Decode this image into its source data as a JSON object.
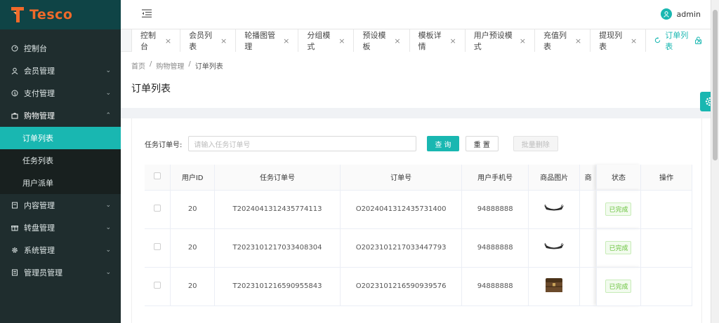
{
  "brand": {
    "name": "Tesco"
  },
  "sidebar": {
    "items": [
      {
        "label": "控制台",
        "icon": "dashboard-icon"
      },
      {
        "label": "会员管理",
        "icon": "user-icon"
      },
      {
        "label": "支付管理",
        "icon": "dollar-icon"
      },
      {
        "label": "购物管理",
        "icon": "bag-icon",
        "open": true
      },
      {
        "label": "订单列表",
        "sub": true,
        "active": true
      },
      {
        "label": "任务列表",
        "sub": true
      },
      {
        "label": "用户派单",
        "sub": true
      },
      {
        "label": "内容管理",
        "icon": "book-icon"
      },
      {
        "label": "转盘管理",
        "icon": "gift-icon"
      },
      {
        "label": "系统管理",
        "icon": "gear-icon"
      },
      {
        "label": "管理员管理",
        "icon": "doc-icon"
      }
    ]
  },
  "header": {
    "user": "admin"
  },
  "tabs": [
    {
      "label": "控制台"
    },
    {
      "label": "会员列表"
    },
    {
      "label": "轮播图管理"
    },
    {
      "label": "分组模式"
    },
    {
      "label": "预设模板"
    },
    {
      "label": "模板详情"
    },
    {
      "label": "用户预设模式"
    },
    {
      "label": "充值列表"
    },
    {
      "label": "提现列表"
    },
    {
      "label": "订单列表",
      "active": true
    }
  ],
  "breadcrumb": {
    "home": "首页",
    "section": "购物管理",
    "current": "订单列表"
  },
  "page": {
    "title": "订单列表"
  },
  "search": {
    "label": "任务订单号:",
    "placeholder": "请输入任务订单号",
    "query_btn": "查 询",
    "reset_btn": "重 置",
    "batch_delete_btn": "批量删除"
  },
  "table": {
    "columns": [
      "用户ID",
      "任务订单号",
      "订单号",
      "用户手机号",
      "商品图片",
      "商",
      "状态",
      "操作"
    ],
    "rows": [
      {
        "user_id": "20",
        "task_no": "T2024041312435774113",
        "order_no": "O2024041312435731400",
        "phone": "94888888",
        "image": "boat",
        "status": "已完成"
      },
      {
        "user_id": "20",
        "task_no": "T2023101217033408304",
        "order_no": "O2023101217033447793",
        "phone": "94888888",
        "image": "boat",
        "status": "已完成"
      },
      {
        "user_id": "20",
        "task_no": "T2023101216590955843",
        "order_no": "O2023101216590939576",
        "phone": "94888888",
        "image": "chest",
        "status": "已完成"
      }
    ]
  },
  "colors": {
    "accent": "#19b7b1",
    "sidebar": "#1f2d2e",
    "brand": "#f06a2a",
    "success": "#67c23a"
  }
}
